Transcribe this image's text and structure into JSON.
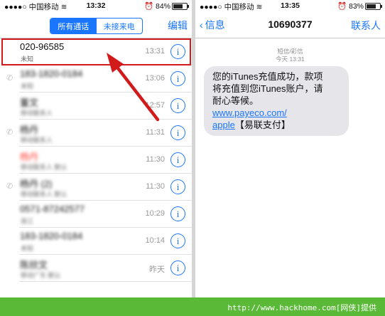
{
  "left": {
    "status": {
      "carrier": "中国移动",
      "time": "13:32",
      "battery": "84%",
      "battery_level": 0.84
    },
    "segmented": {
      "all": "所有通话",
      "missed": "未接来电"
    },
    "edit": "编辑",
    "calls": [
      {
        "name": "020-96585",
        "sub": "未知",
        "time": "13:31",
        "blurred": false,
        "missed": false,
        "phone_icon": false
      },
      {
        "name": "183-1820-0184",
        "sub": "未知",
        "time": "13:06",
        "blurred": true,
        "missed": false,
        "phone_icon": true
      },
      {
        "name": "董文",
        "sub": "移动联系人",
        "time": "12:57",
        "blurred": true,
        "missed": false,
        "phone_icon": false
      },
      {
        "name": "杨丹",
        "sub": "移动联系人",
        "time": "11:31",
        "blurred": true,
        "missed": false,
        "phone_icon": true
      },
      {
        "name": "杨丹",
        "sub": "移动联系人 默认",
        "time": "11:30",
        "blurred": true,
        "missed": true,
        "phone_icon": false
      },
      {
        "name": "杨丹 (2)",
        "sub": "移动联系人 默认",
        "time": "11:30",
        "blurred": true,
        "missed": false,
        "phone_icon": true
      },
      {
        "name": "0571-87242577",
        "sub": "浙江",
        "time": "10:29",
        "blurred": true,
        "missed": false,
        "phone_icon": false
      },
      {
        "name": "183-1820-0184",
        "sub": "未知",
        "time": "10:14",
        "blurred": true,
        "missed": false,
        "phone_icon": false
      },
      {
        "name": "陈欣文",
        "sub": "移动广东 默认",
        "time": "昨天",
        "blurred": true,
        "missed": false,
        "phone_icon": false
      }
    ],
    "info_glyph": "i"
  },
  "right": {
    "status": {
      "carrier": "中国移动",
      "time": "13:35",
      "battery": "83%",
      "battery_level": 0.83
    },
    "back": "信息",
    "title": "10690377",
    "contact": "联系人",
    "meta_type": "短信/彩信",
    "meta_time": "今天 13:31",
    "message": {
      "line1": "您的iTunes充值成功，款项",
      "line2": "将充值到您iTunes账户，请",
      "line3": "耐心等候。",
      "link1": "www.payeco.com/",
      "link2": "apple",
      "tail": "【易联支付】"
    }
  },
  "footer": {
    "url": "http://www.hackhome.com[网侠]提供"
  },
  "colors": {
    "accent": "#1a75ff",
    "highlight": "#d21a1a",
    "footer": "#5ab936",
    "bubble": "#e5e5ea"
  }
}
